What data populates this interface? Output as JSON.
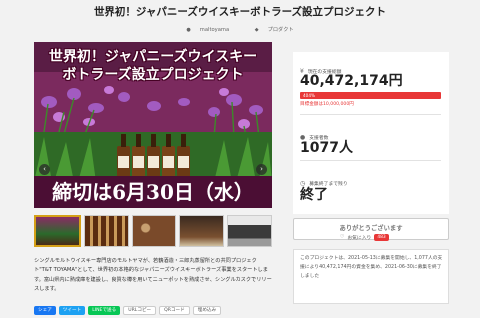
{
  "page": {
    "title": "世界初！ジャパニーズウイスキーボトラーズ設立プロジェクト",
    "author": "maltoyama",
    "category": "プロダクト"
  },
  "hero": {
    "overlay_title_line1": "世界初！ジャパニーズウイスキー",
    "overlay_title_line2": "ボトラーズ設立プロジェクト",
    "deadline": "締切は6月30日（水）",
    "prev_arrow": "‹",
    "next_arrow": "›"
  },
  "description": "シングルモルトウイスキー専門店のモルトヤマが、若鶴酒造・三郎丸蒸留所との共同プロジェクト\"T&T TOYAMA\"として、世界初の本格的なジャパニーズウイスキーボトラーズ事業をスタートします。富山県内に熟成庫を建設し、良質な樽を用いてニューポットを熟成させ、シングルカスクでリリースします。",
  "share": {
    "facebook": "シェア",
    "twitter": "ツイート",
    "line": "LINEで送る",
    "url_copy": "URLコピー",
    "qr": "QRコード",
    "embed": "埋め込み"
  },
  "stats": {
    "current_label": "現在の支援総額",
    "current_amount": "40,472,174円",
    "progress_percent": 404,
    "progress_text": "404%",
    "goal_text": "目標金額は10,000,000円",
    "supporters_label": "支援者数",
    "supporters": "1077人",
    "remaining_label": "募集終了まで残り",
    "remaining": "終了"
  },
  "support_button": "ありがとうございます",
  "favorite": {
    "label": "お気に入り",
    "count": "483"
  },
  "summary": "このプロジェクトは、2021-05-13に募集を開始し、1,077人の支援により40,472,174円の資金を集め、2021-06-30に募集を終了しました"
}
